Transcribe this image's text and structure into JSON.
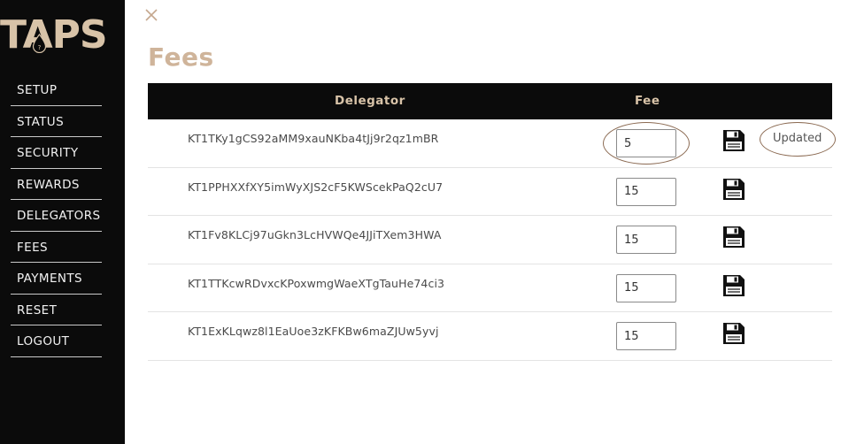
{
  "app": {
    "logo": "TAPS",
    "logo_badge": "?"
  },
  "nav": {
    "items": [
      {
        "label": "SETUP"
      },
      {
        "label": "STATUS"
      },
      {
        "label": "SECURITY"
      },
      {
        "label": "REWARDS"
      },
      {
        "label": "DELEGATORS"
      },
      {
        "label": "FEES"
      },
      {
        "label": "PAYMENTS"
      },
      {
        "label": "RESET"
      },
      {
        "label": "LOGOUT"
      }
    ]
  },
  "page": {
    "title": "Fees",
    "close_icon": "close-icon"
  },
  "table": {
    "headers": {
      "delegator": "Delegator",
      "fee": "Fee"
    },
    "rows": [
      {
        "delegator": "KT1TKy1gCS92aMM9xauNKba4tJj9r2qz1mBR",
        "fee": "5",
        "status": "Updated"
      },
      {
        "delegator": "KT1PPHXXfXY5imWyXJS2cF5KWScekPaQ2cU7",
        "fee": "15",
        "status": ""
      },
      {
        "delegator": "KT1Fv8KLCj97uGkn3LcHVWQe4JJiTXem3HWA",
        "fee": "15",
        "status": ""
      },
      {
        "delegator": "KT1TTKcwRDvxcKPoxwmgWaeXTgTauHe74ci3",
        "fee": "15",
        "status": ""
      },
      {
        "delegator": "KT1ExKLqwz8l1EaUoe3zKFKBw6maZJUw5yvj",
        "fee": "15",
        "status": ""
      }
    ]
  },
  "colors": {
    "sidebar": "#0b0b0b",
    "accent": "#cfb49a",
    "annotation": "#8b6a52"
  }
}
